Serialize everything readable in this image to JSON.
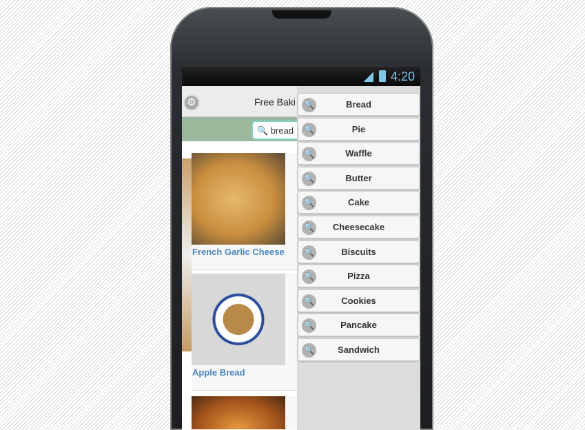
{
  "status": {
    "time": "4:20"
  },
  "header": {
    "title": "Free Baki"
  },
  "search": {
    "value": "bread"
  },
  "recipes": [
    {
      "label": "French Garlic Cheese"
    },
    {
      "label": "Apple Bread"
    },
    {
      "label": ""
    }
  ],
  "menu": {
    "items": [
      "Bread",
      "Pie",
      "Waffle",
      "Butter",
      "Cake",
      "Cheesecake",
      "Biscuits",
      "Pizza",
      "Cookies",
      "Pancake",
      "Sandwich"
    ]
  },
  "colors": {
    "accent": "#4a86c2",
    "band": "#9bb89c",
    "status": "#7fc6e8"
  }
}
